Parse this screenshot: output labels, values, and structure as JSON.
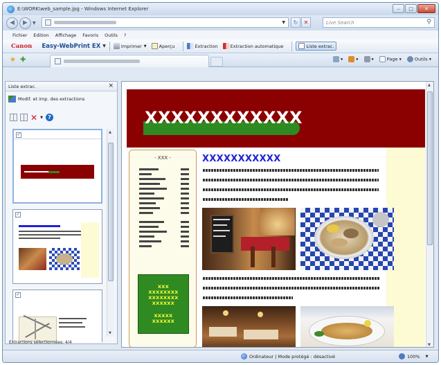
{
  "window": {
    "title": "E:\\WORK\\web_sample.jpg - Windows Internet Explorer",
    "controls": [
      "minimize",
      "maximize",
      "close"
    ]
  },
  "address_bar": {
    "url_blurred": true,
    "search_placeholder": "Live Search"
  },
  "menu": {
    "items": [
      "Fichier",
      "Edition",
      "Affichage",
      "Favoris",
      "Outils",
      "?"
    ]
  },
  "canon_toolbar": {
    "brand": "Canon",
    "product": "Easy-WebPrint EX",
    "print_label": "Imprimer",
    "preview_label": "Aperçu",
    "extract_label": "Extraction",
    "auto_extract_label": "Extraction automatique",
    "list_label": "Liste extrac."
  },
  "command_bar": {
    "page_label": "Page",
    "tools_label": "Outils"
  },
  "left_pane": {
    "title": "Liste extrac.",
    "close": "×",
    "action_label": "Modif. et imp. des extractions",
    "status": "Extractions sélectionnées: 4/4",
    "thumbnails": [
      {
        "checked": true,
        "selected": true
      },
      {
        "checked": true,
        "selected": false
      },
      {
        "checked": true,
        "selected": false
      }
    ]
  },
  "web_page": {
    "header_title": "XXXXXXXXXXXX",
    "sidebar_heading": "- XXX -",
    "green_box_lines": [
      "XXX",
      "XXXXXXXX",
      "XXXXXXXX",
      "XXXXXX",
      "XXXXX",
      "XXXXXX"
    ],
    "main_title": "XXXXXXXXXXX"
  },
  "status_bar": {
    "zone_text": "Ordinateur | Mode protégé : désactivé",
    "zoom": "100%"
  },
  "colors": {
    "header_red": "#8b0000",
    "green": "#2e8a21",
    "title_blue": "#1f22d6",
    "cream": "#fdfbd3",
    "canon_red": "#cc1922"
  }
}
